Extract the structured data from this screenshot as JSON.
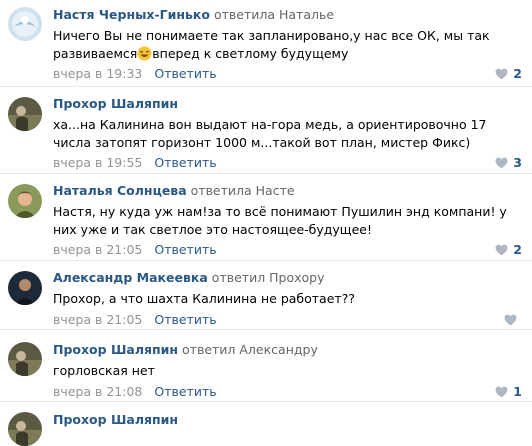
{
  "comments": [
    {
      "author": "Настя Черных-Гинько",
      "reply_to": "ответила Наталье",
      "text_before_emoji": "Ничего Вы не понимаете так запланировано,у нас все ОК, мы так развиваемся",
      "emoji_name": "laughing-face-emoji",
      "text_after_emoji": "вперед к светлому будущему",
      "time": "вчера в 19:33",
      "reply_label": "Ответить",
      "likes": "2"
    },
    {
      "author": "Прохор Шаляпин",
      "reply_to": "",
      "text": "ха...на Калинина вон выдают на-гора медь, а ориентировочно 17 числа затопят горизонт 1000 м...такой вот план, мистер Фикс)",
      "time": "вчера в 19:55",
      "reply_label": "Ответить",
      "likes": "3"
    },
    {
      "author": "Наталья Солнцева",
      "reply_to": "ответила Насте",
      "text": "Настя, ну куда уж нам!за то всё понимают Пушилин энд компани! у них уже и так светлое это настоящее-будущее!",
      "time": "вчера в 21:05",
      "reply_label": "Ответить",
      "likes": "2"
    },
    {
      "author": "Александр Макеевка",
      "reply_to": "ответил Прохору",
      "text": "Прохор, а что шахта Калинина не работает??",
      "time": "вчера в 21:05",
      "reply_label": "Ответить",
      "likes": ""
    },
    {
      "author": "Прохор Шаляпин",
      "reply_to": "ответил Александру",
      "text": "горловская нет",
      "time": "вчера в 21:08",
      "reply_label": "Ответить",
      "likes": "1"
    },
    {
      "author": "Прохор Шаляпин",
      "reply_to": "",
      "text": "",
      "time": "",
      "reply_label": "",
      "likes": ""
    }
  ],
  "colors": {
    "author": "#2a5885",
    "meta": "#939393",
    "divider": "#e7e8ec",
    "like_heart": "#aeb7c2"
  },
  "icons": {
    "like": "heart-icon"
  }
}
